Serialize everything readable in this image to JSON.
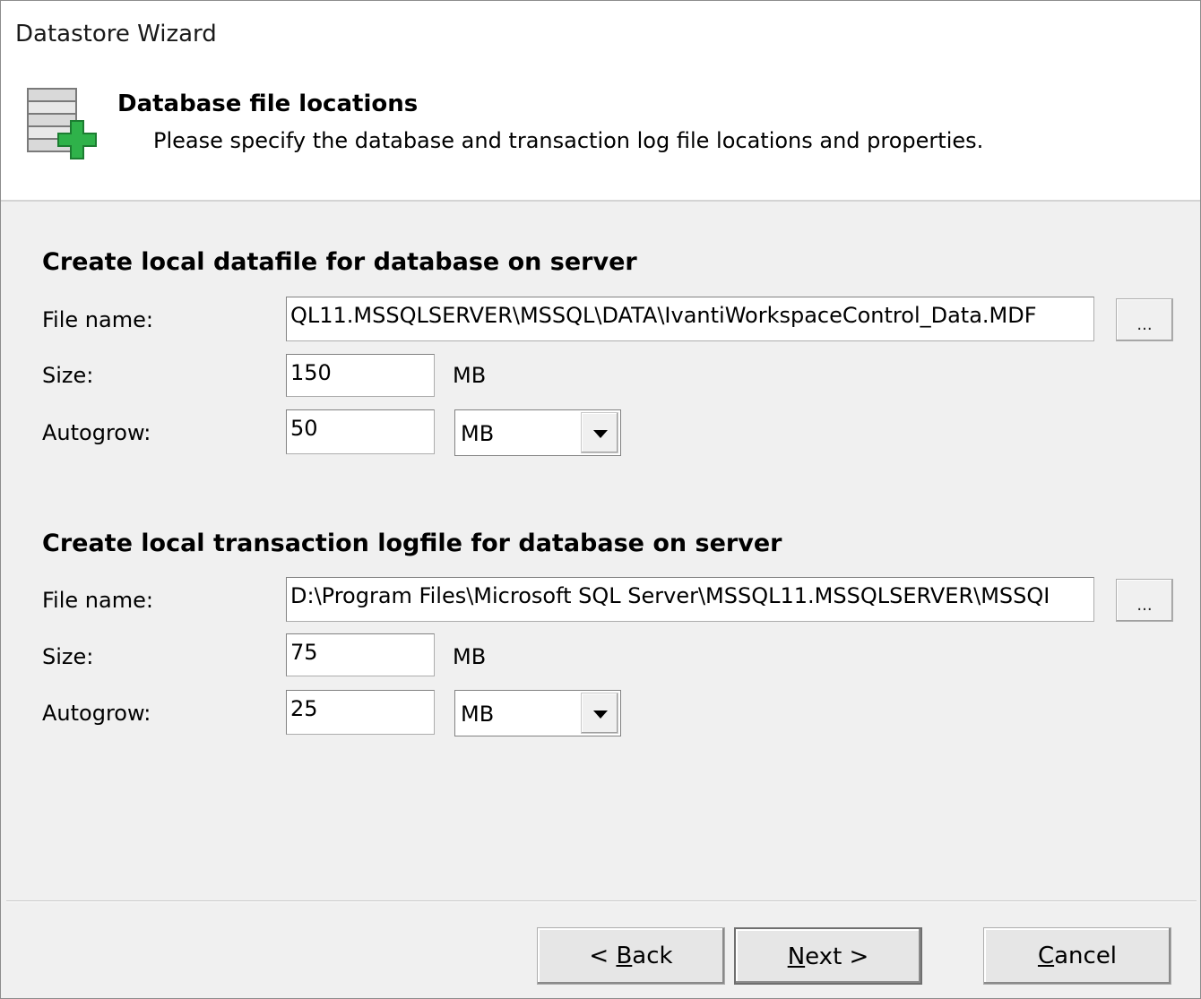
{
  "window": {
    "title": "Datastore Wizard"
  },
  "header": {
    "title": "Database file locations",
    "subtitle": "Please specify the database and transaction log file locations and properties.",
    "icon": "database-add-icon"
  },
  "data_section": {
    "title": "Create local datafile for database on server",
    "file_name_label": "File name:",
    "file_name_value": "QL11.MSSQLSERVER\\MSSQL\\DATA\\IvantiWorkspaceControl_Data.MDF",
    "browse_label": "...",
    "size_label": "Size:",
    "size_value": "150",
    "size_unit": "MB",
    "autogrow_label": "Autogrow:",
    "autogrow_value": "50",
    "autogrow_unit": "MB"
  },
  "log_section": {
    "title": "Create local transaction logfile for database on server",
    "file_name_label": "File name:",
    "file_name_value": "D:\\Program Files\\Microsoft SQL Server\\MSSQL11.MSSQLSERVER\\MSSQI",
    "browse_label": "...",
    "size_label": "Size:",
    "size_value": "75",
    "size_unit": "MB",
    "autogrow_label": "Autogrow:",
    "autogrow_value": "25",
    "autogrow_unit": "MB"
  },
  "buttons": {
    "back": {
      "prefix": "< ",
      "mnemonic": "B",
      "rest": "ack"
    },
    "next": {
      "mnemonic": "N",
      "rest": "ext >"
    },
    "cancel": {
      "mnemonic": "C",
      "rest": "ancel"
    }
  },
  "colors": {
    "dialog_bg": "#f0f0f0",
    "header_bg": "#ffffff",
    "icon_green": "#2fb24a"
  }
}
